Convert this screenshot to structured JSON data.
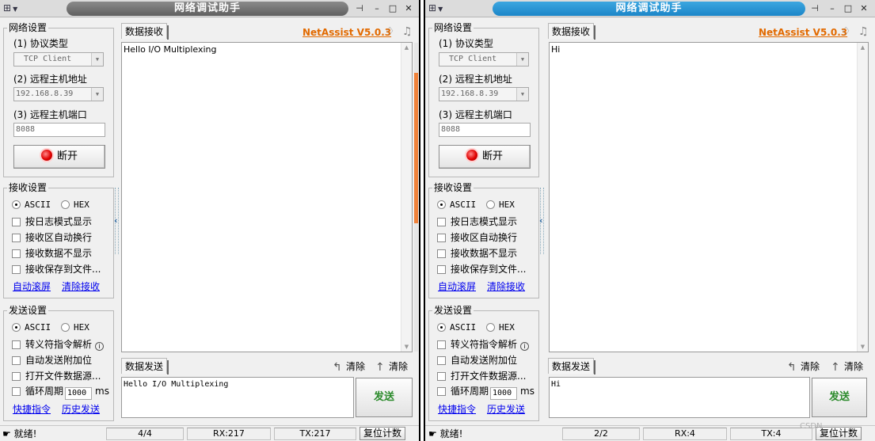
{
  "left": {
    "title": "网络调试助手",
    "net": {
      "group": "网络设置",
      "protocol_label": "(1) 协议类型",
      "protocol_value": "TCP Client",
      "host_label": "(2) 远程主机地址",
      "host_value": "192.168.8.39",
      "port_label": "(3) 远程主机端口",
      "port_value": "8088",
      "connect_button": "断开"
    },
    "recv": {
      "group": "接收设置",
      "ascii": "ASCII",
      "hex": "HEX",
      "opt1": "按日志模式显示",
      "opt2": "接收区自动换行",
      "opt3": "接收数据不显示",
      "opt4": "接收保存到文件...",
      "link1": "自动滚屏",
      "link2": "清除接收"
    },
    "send": {
      "group": "发送设置",
      "ascii": "ASCII",
      "hex": "HEX",
      "opt1": "转义符指令解析",
      "opt2": "自动发送附加位",
      "opt3": "打开文件数据源...",
      "opt4": "循环周期",
      "period": "1000",
      "ms": "ms",
      "link1": "快捷指令",
      "link2": "历史发送"
    },
    "receive_tab": "数据接收",
    "brand": "NetAssist V5.0.3",
    "received_text": "Hello I/O Multiplexing",
    "send_tab": "数据发送",
    "clear1": "清除",
    "clear2": "清除",
    "send_text": "Hello I/O Multiplexing",
    "send_button": "发送",
    "status": {
      "ready": "就绪!",
      "count": "4/4",
      "rx": "RX:217",
      "tx": "TX:217",
      "reset": "复位计数"
    }
  },
  "right": {
    "title": "网络调试助手",
    "net": {
      "group": "网络设置",
      "protocol_label": "(1) 协议类型",
      "protocol_value": "TCP Client",
      "host_label": "(2) 远程主机地址",
      "host_value": "192.168.8.39",
      "port_label": "(3) 远程主机端口",
      "port_value": "8088",
      "connect_button": "断开"
    },
    "recv": {
      "group": "接收设置",
      "ascii": "ASCII",
      "hex": "HEX",
      "opt1": "按日志模式显示",
      "opt2": "接收区自动换行",
      "opt3": "接收数据不显示",
      "opt4": "接收保存到文件...",
      "link1": "自动滚屏",
      "link2": "清除接收"
    },
    "send": {
      "group": "发送设置",
      "ascii": "ASCII",
      "hex": "HEX",
      "opt1": "转义符指令解析",
      "opt2": "自动发送附加位",
      "opt3": "打开文件数据源...",
      "opt4": "循环周期",
      "period": "1000",
      "ms": "ms",
      "link1": "快捷指令",
      "link2": "历史发送"
    },
    "receive_tab": "数据接收",
    "brand": "NetAssist V5.0.3",
    "received_text": "Hi",
    "send_tab": "数据发送",
    "clear1": "清除",
    "clear2": "清除",
    "send_text": "Hi",
    "send_button": "发送",
    "status": {
      "ready": "就绪!",
      "count": "2/2",
      "rx": "RX:4",
      "tx": "TX:4",
      "reset": "复位计数"
    }
  },
  "colors": {
    "left_title_bar": "#707070",
    "right_title_bar": "#2a96d4",
    "brand": "#e26a00",
    "link": "#0000ee",
    "led": "#e00000",
    "scroll_thumb": "#f0823a",
    "send_text": "#2a8a2a"
  },
  "icons": [
    "app-icon",
    "pin-icon",
    "minimize-icon",
    "maximize-icon",
    "close-icon",
    "gem-icon",
    "bell-icon",
    "led-icon",
    "clear-send-icon",
    "clear-count-icon",
    "ready-icon",
    "info-icon",
    "collapse-arrow-icon"
  ],
  "watermark": "CSDN"
}
